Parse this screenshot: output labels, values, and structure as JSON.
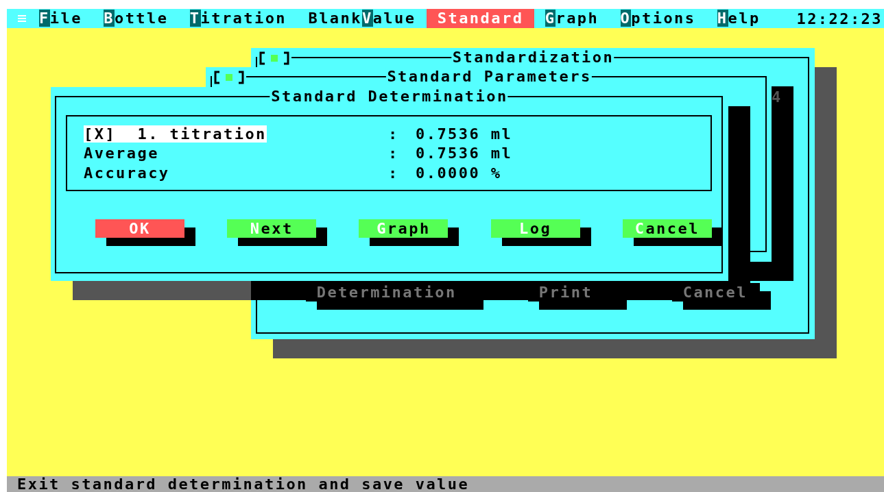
{
  "menu": {
    "items": [
      {
        "key": "F",
        "rest": "ile",
        "selected": false
      },
      {
        "key": "B",
        "rest": "ottle",
        "selected": false
      },
      {
        "key": "T",
        "rest": "itration",
        "selected": false
      },
      {
        "pre": "Blank",
        "key": "V",
        "rest": "alue",
        "selected": false
      },
      {
        "key": "S",
        "rest": "tandard",
        "selected": true
      },
      {
        "key": "G",
        "rest": "raph",
        "selected": false
      },
      {
        "key": "O",
        "rest": "ptions",
        "selected": false
      },
      {
        "key": "H",
        "rest": "elp",
        "selected": false
      }
    ],
    "time": "12:22:23"
  },
  "standardization_window": {
    "title": "Standardization",
    "label": "4",
    "buttons": [
      {
        "label": "Determination"
      },
      {
        "label": "Print"
      },
      {
        "label": "Cancel"
      }
    ]
  },
  "parameters_window": {
    "title": "Standard Parameters"
  },
  "determination_window": {
    "title": "Standard Determination",
    "rows": [
      {
        "label": "[X]  1. titration",
        "selected": true,
        "separator": ":",
        "value": "0.7536 ml"
      },
      {
        "label": "Average",
        "selected": false,
        "separator": ":",
        "value": "0.7536 ml"
      },
      {
        "label": "Accuracy",
        "selected": false,
        "separator": ":",
        "value": "0.0000 %"
      }
    ],
    "buttons": [
      {
        "rest": "OK",
        "default": true
      },
      {
        "key": "N",
        "rest": "ext",
        "default": false
      },
      {
        "key": "G",
        "rest": "raph",
        "default": false
      },
      {
        "key": "L",
        "rest": "og",
        "default": false
      },
      {
        "key": "C",
        "rest": "ancel",
        "default": false
      }
    ]
  },
  "status_bar": "Exit standard determination and save value"
}
